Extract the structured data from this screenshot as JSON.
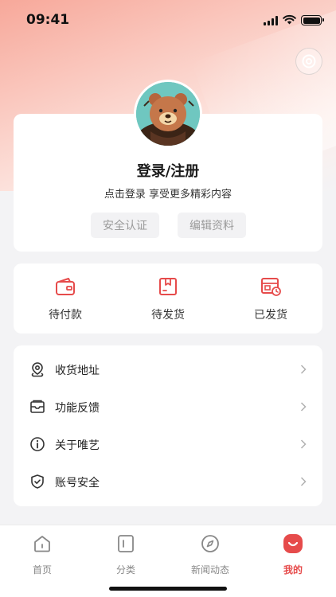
{
  "status_bar": {
    "time": "09:41"
  },
  "profile": {
    "title": "登录/注册",
    "subtitle": "点击登录 享受更多精彩内容",
    "buttons": [
      "安全认证",
      "编辑资料"
    ]
  },
  "orders": {
    "items": [
      {
        "label": "待付款",
        "icon": "wallet-icon"
      },
      {
        "label": "待发货",
        "icon": "package-icon"
      },
      {
        "label": "已发货",
        "icon": "shipped-icon"
      }
    ]
  },
  "menu": {
    "items": [
      {
        "label": "收货地址",
        "icon": "location-icon"
      },
      {
        "label": "功能反馈",
        "icon": "mail-icon"
      },
      {
        "label": "关于唯艺",
        "icon": "info-icon"
      },
      {
        "label": "账号安全",
        "icon": "shield-icon"
      }
    ]
  },
  "tabbar": {
    "items": [
      {
        "label": "首页",
        "icon": "home-icon"
      },
      {
        "label": "分类",
        "icon": "category-icon"
      },
      {
        "label": "新闻动态",
        "icon": "compass-icon"
      },
      {
        "label": "我的",
        "icon": "profile-icon"
      }
    ],
    "active_index": 3
  },
  "colors": {
    "accent": "#e64b4b",
    "background": "#f3f3f5"
  }
}
